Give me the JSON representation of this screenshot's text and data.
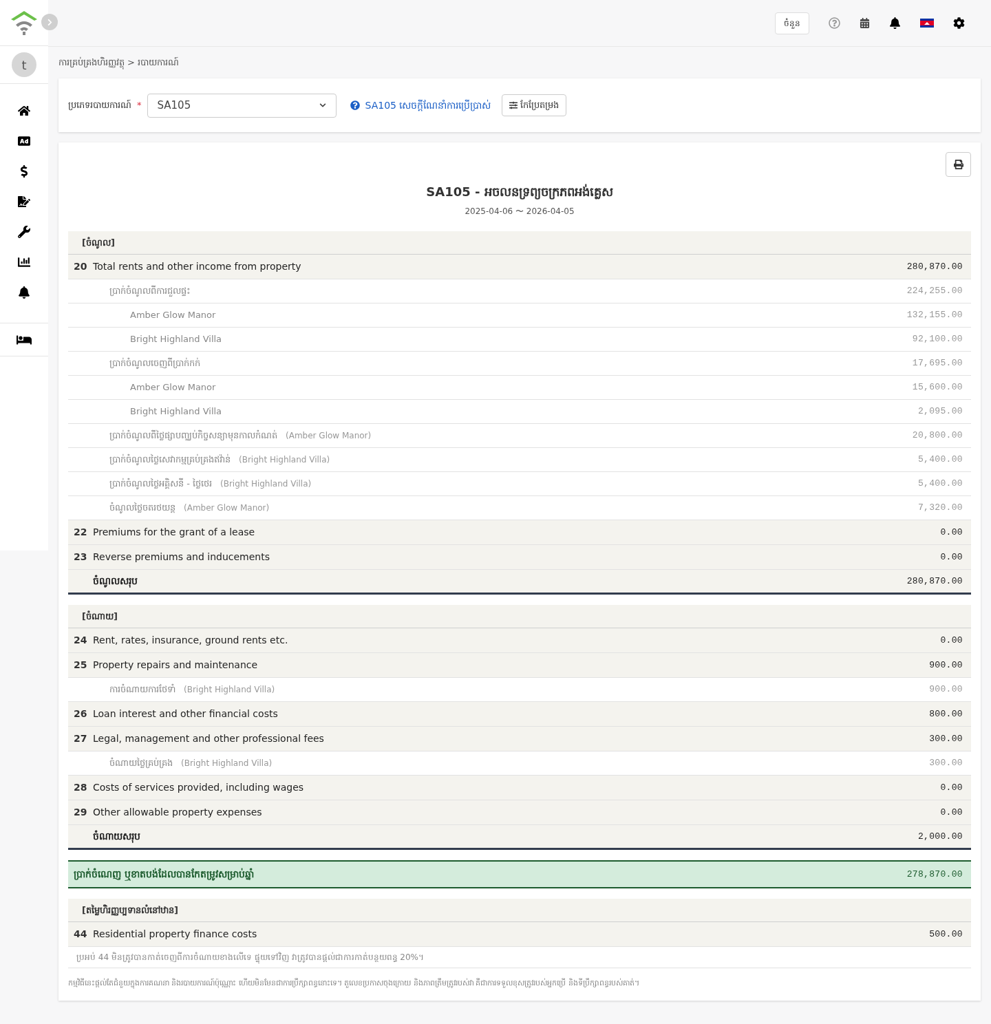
{
  "top_bar": {
    "button": "ចំនួន"
  },
  "sidebar": {
    "avatar": "t"
  },
  "breadcrumb": [
    "ការគ្រប់គ្រងហិរញ្ញវត្ថុ",
    "របាយការណ៍"
  ],
  "breadcrumb_separator": ">",
  "filter": {
    "label": "ប្រភេទរបាយការណ៍",
    "required_mark": "*",
    "value": "SA105",
    "help_link": "SA105 សេចក្តីណែនាំការប្រើប្រាស់",
    "edit_button": "កែប្រែតម្រង"
  },
  "report": {
    "title": "SA105 - អចលនទ្រព្យចក្រភពអង់គ្លេស",
    "period": "2025-04-06 〜 2026-04-05",
    "sections": [
      {
        "heading": "[ចំណូល]",
        "rows": [
          {
            "number": "20",
            "label": "Total rents and other income from property",
            "amount": "280,870.00",
            "children": [
              {
                "label": "ប្រាក់ចំណូលពីការជួលផ្ទះ",
                "amount": "224,255.00",
                "children": [
                  {
                    "label": "Amber Glow Manor",
                    "amount": "132,155.00"
                  },
                  {
                    "label": "Bright Highland Villa",
                    "amount": "92,100.00"
                  }
                ]
              },
              {
                "label": "ប្រាក់ចំណូលចេញពីប្រាក់កក់",
                "amount": "17,695.00",
                "children": [
                  {
                    "label": "Amber Glow Manor",
                    "amount": "15,600.00"
                  },
                  {
                    "label": "Bright Highland Villa",
                    "amount": "2,095.00"
                  }
                ]
              },
              {
                "label": "ប្រាក់ចំណូលពីថ្លៃផ្សាបញ្ឈប់កិច្ចសន្យាមុនកាលកំណត់",
                "note": "(Amber Glow Manor)",
                "amount": "20,800.00"
              },
              {
                "label": "ប្រាក់ចំណូលថ្លៃសេវាកម្មគ្រប់គ្រងឥវ៉ាន់",
                "note": "(Bright Highland Villa)",
                "amount": "5,400.00"
              },
              {
                "label": "ប្រាក់ចំណូលថ្លៃអគ្គិសនី - ថ្លៃថេរ",
                "note": "(Bright Highland Villa)",
                "amount": "5,400.00"
              },
              {
                "label": "ចំណូលថ្លៃចតរថយន្ត",
                "note": "(Amber Glow Manor)",
                "amount": "7,320.00"
              }
            ]
          },
          {
            "number": "22",
            "label": "Premiums for the grant of a lease",
            "amount": "0.00"
          },
          {
            "number": "23",
            "label": "Reverse premiums and inducements",
            "amount": "0.00"
          }
        ],
        "total": {
          "label": "ចំណូលសរុប",
          "amount": "280,870.00"
        }
      },
      {
        "heading": "[ចំណាយ]",
        "rows": [
          {
            "number": "24",
            "label": "Rent, rates, insurance, ground rents etc.",
            "amount": "0.00"
          },
          {
            "number": "25",
            "label": "Property repairs and maintenance",
            "amount": "900.00",
            "children": [
              {
                "label": "ការចំណាយការថែទាំ",
                "note": "(Bright Highland Villa)",
                "amount": "900.00"
              }
            ]
          },
          {
            "number": "26",
            "label": "Loan interest and other financial costs",
            "amount": "800.00"
          },
          {
            "number": "27",
            "label": "Legal, management and other professional fees",
            "amount": "300.00",
            "children": [
              {
                "label": "ចំណាយថ្លៃគ្រប់គ្រង",
                "note": "(Bright Highland Villa)",
                "amount": "300.00"
              }
            ]
          },
          {
            "number": "28",
            "label": "Costs of services provided, including wages",
            "amount": "0.00"
          },
          {
            "number": "29",
            "label": "Other allowable property expenses",
            "amount": "0.00"
          }
        ],
        "total": {
          "label": "ចំណាយសរុប",
          "amount": "2,000.00"
        }
      }
    ],
    "net": {
      "label": "ប្រាក់ចំណេញ ឬខាតបង់ដែលបានកែតម្រូវសម្រាប់ឆ្នាំ",
      "amount": "278,870.00"
    },
    "finance": {
      "heading": "[តម្លៃហិរញ្ញប្បទានលំនៅឋាន]",
      "rows": [
        {
          "number": "44",
          "label": "Residential property finance costs",
          "amount": "500.00"
        }
      ],
      "footnote": "ប្រអប់ 44 មិនត្រូវបានកាត់ចេញពីការចំណាយខាងលើទេ ផ្ទុយទៅវិញ វាត្រូវបានផ្តល់ជាការកាត់បន្ថយពន្ធ 20%។"
    },
    "disclaimer": "កម្មវិធីនេះផ្តល់តែជំនួយក្នុងការគណនា និងរបាយការណ៍ប៉ុណ្ណោះ ហើយមិនមែនជាការប្រឹក្សាពន្ធនោះទេ។ តួលេខប្រកាសចុងក្រោយ និងភាពត្រឹមត្រូវរបស់វា គឺជាការទទួលខុសត្រូវរបស់អ្នកប្រើ និងទីប្រឹក្សាពន្ធរបស់គាត់។"
  }
}
